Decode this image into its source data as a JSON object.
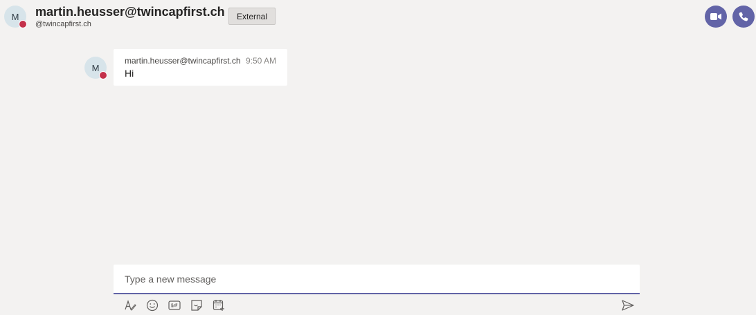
{
  "header": {
    "avatar_initial": "M",
    "title": "martin.heusser@twincapfirst.ch",
    "subtitle": "@twincapfirst.ch",
    "badge": "External",
    "icons": [
      "video-call-icon",
      "audio-call-icon"
    ]
  },
  "messages": [
    {
      "avatar_initial": "M",
      "sender": "martin.heusser@twincapfirst.ch",
      "time": "9:50 AM",
      "text": "Hi"
    }
  ],
  "composer": {
    "placeholder": "Type a new message",
    "toolbar": [
      "format-icon",
      "emoji-icon",
      "gif-icon",
      "sticker-icon",
      "schedule-meeting-icon"
    ],
    "send_icon": "send-icon"
  },
  "colors": {
    "accent": "#6264a7",
    "status_busy": "#c4314b",
    "background": "#f3f2f1"
  }
}
